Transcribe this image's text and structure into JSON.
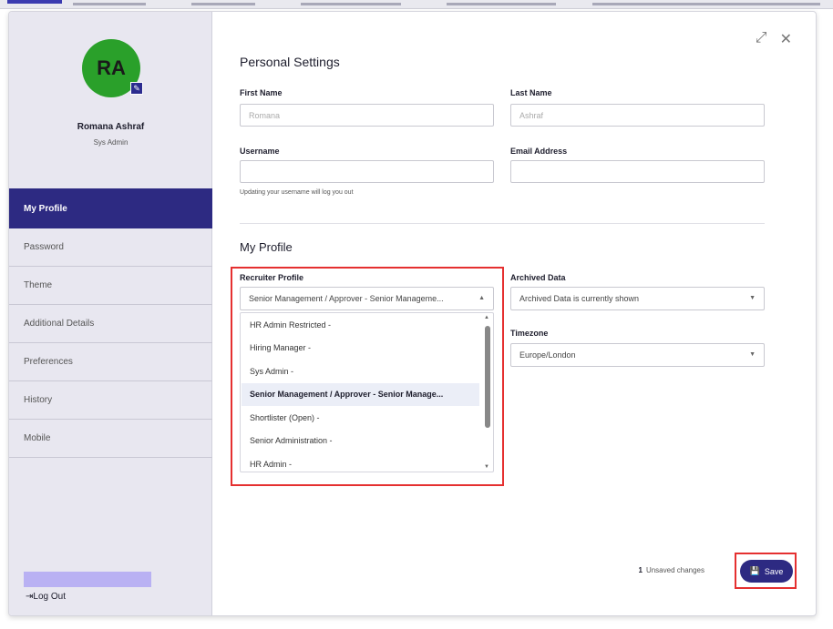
{
  "sidebar": {
    "avatar_initials": "RA",
    "user_name": "Romana Ashraf",
    "user_role": "Sys Admin",
    "items": [
      {
        "label": "My Profile",
        "active": true
      },
      {
        "label": "Password"
      },
      {
        "label": "Theme"
      },
      {
        "label": "Additional Details"
      },
      {
        "label": "Preferences"
      },
      {
        "label": "History"
      },
      {
        "label": "Mobile"
      }
    ],
    "logout_label": "Log Out"
  },
  "main": {
    "title": "Personal Settings",
    "first_name": {
      "label": "First Name",
      "placeholder": "Romana"
    },
    "last_name": {
      "label": "Last Name",
      "placeholder": "Ashraf"
    },
    "username": {
      "label": "Username",
      "value": "",
      "hint": "Updating your username will log you out"
    },
    "email": {
      "label": "Email Address",
      "value": ""
    },
    "profile_section_title": "My Profile",
    "recruiter_profile": {
      "label": "Recruiter Profile",
      "selected": "Senior Management / Approver - Senior Manageme...",
      "options": [
        "HR Admin Restricted -",
        "Hiring Manager -",
        "Sys Admin -",
        "Senior Management / Approver - Senior Manage...",
        "Shortlister (Open) -",
        "Senior Administration -",
        "HR Admin -"
      ],
      "highlighted_index": 3
    },
    "archived_data": {
      "label": "Archived Data",
      "selected": "Archived Data is currently shown"
    },
    "timezone": {
      "label": "Timezone",
      "selected": "Europe/London"
    }
  },
  "footer": {
    "unsaved_count": "1",
    "unsaved_label": "Unsaved changes",
    "save_label": "Save"
  },
  "colors": {
    "accent": "#2d2a82",
    "avatar": "#2aa02a",
    "highlight_box": "#e53030"
  }
}
